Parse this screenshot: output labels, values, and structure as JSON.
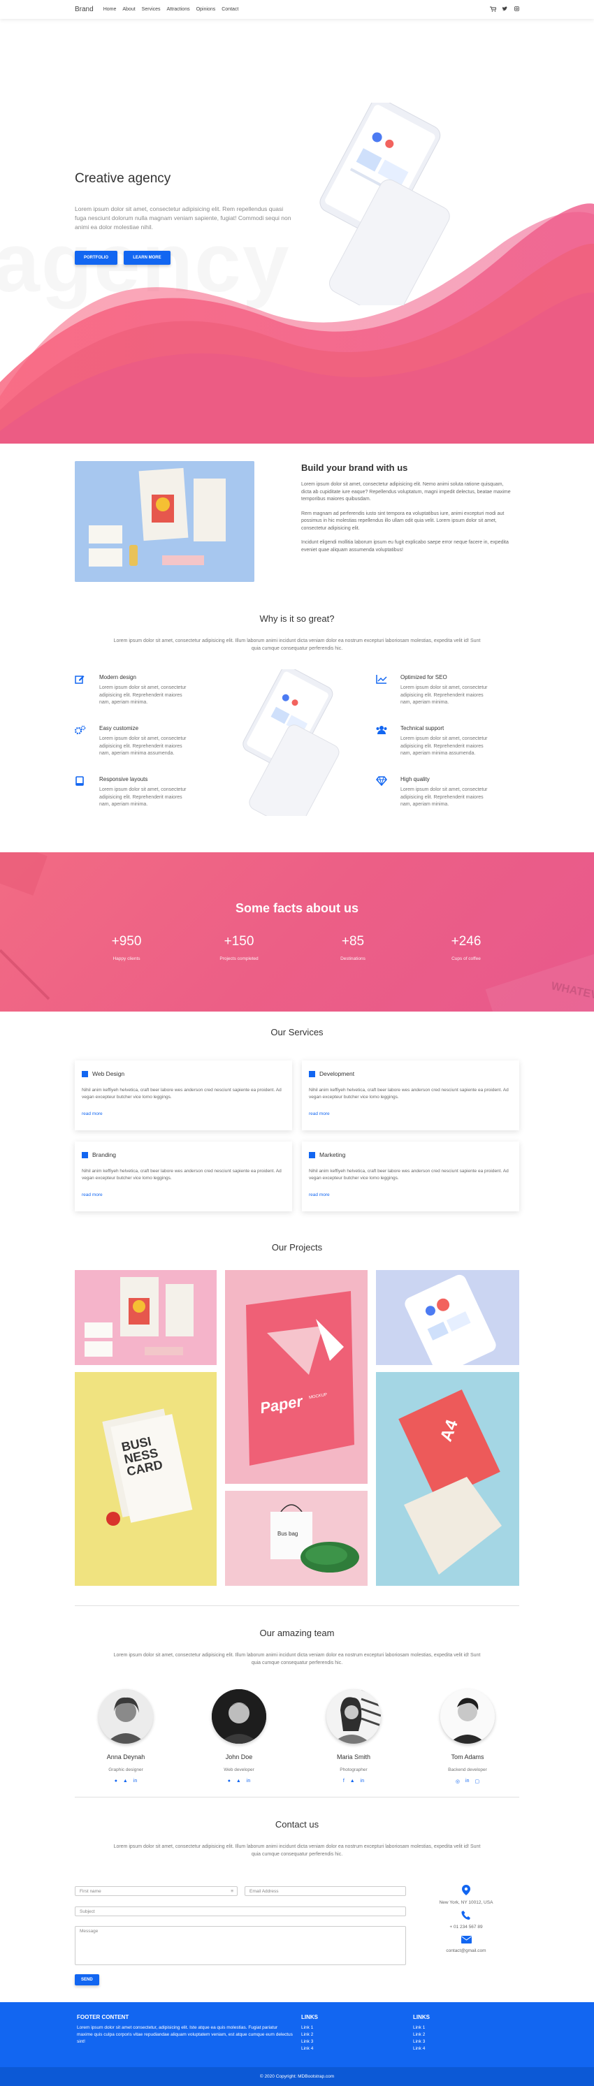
{
  "navbar": {
    "brand": "Brand",
    "links": [
      "Home",
      "About",
      "Services",
      "Attractions",
      "Opinions",
      "Contact"
    ]
  },
  "hero": {
    "title": "Creative agency",
    "text": "Lorem ipsum dolor sit amet, consectetur adipisicing elit. Rem repellendus quasi fuga nesciunt dolorum nulla magnam veniam sapiente, fugiat! Commodi sequi non animi ea dolor molestiae nihil.",
    "bg_text": "agency",
    "btn_portfolio": "PORTFOLIO",
    "btn_learn": "LEARN MORE"
  },
  "brand_section": {
    "title": "Build your brand with us",
    "p1": "Lorem ipsum dolor sit amet, consectetur adipisicing elit. Nemo animi soluta ratione quisquam, dicta ab cupiditate iure eaque? Repellendus voluptatum, magni impedit delectus, beatae maxime temporibus maiores quibusdam.",
    "p2": "Rem magnam ad perferendis iusto sint tempora ea voluptatibus iure, animi excepturi modi aut possimus in hic molestias repellendus illo ullam odit quia velit. Lorem ipsum dolor sit amet, consectetur adipisicing elit.",
    "p3": "Incidunt eligendi mollitia laborum ipsum eu fugit explicabo saepe error neque facere in, expedita eveniet quae aliquam assumenda voluptatibus!"
  },
  "why": {
    "title": "Why is it so great?",
    "subtitle": "Lorem ipsum dolor sit amet, consectetur adipisicing elit. Illum laborum animi incidunt dicta veniam dolor ea nostrum excepturi laboriosam molestias, expedita velit id! Sunt quia cumque consequatur perferendis hic.",
    "features": [
      {
        "title": "Modern design",
        "text": "Lorem ipsum dolor sit amet, consectetur adipisicing elit. Reprehenderit maiores nam, aperiam minima."
      },
      {
        "title": "Easy customize",
        "text": "Lorem ipsum dolor sit amet, consectetur adipisicing elit. Reprehenderit maiores nam, aperiam minima assumenda."
      },
      {
        "title": "Responsive layouts",
        "text": "Lorem ipsum dolor sit amet, consectetur adipisicing elit. Reprehenderit maiores nam, aperiam minima."
      },
      {
        "title": "Optimized for SEO",
        "text": "Lorem ipsum dolor sit amet, consectetur adipisicing elit. Reprehenderit maiores nam, aperiam minima."
      },
      {
        "title": "Technical support",
        "text": "Lorem ipsum dolor sit amet, consectetur adipisicing elit. Reprehenderit maiores nam, aperiam minima assumenda."
      },
      {
        "title": "High quality",
        "text": "Lorem ipsum dolor sit amet, consectetur adipisicing elit. Reprehenderit maiores nam, aperiam minima."
      }
    ]
  },
  "facts": {
    "title": "Some facts about us",
    "items": [
      {
        "num": "+950",
        "label": "Happy clients"
      },
      {
        "num": "+150",
        "label": "Projects completed"
      },
      {
        "num": "+85",
        "label": "Destinations"
      },
      {
        "num": "+246",
        "label": "Cups of coffee"
      }
    ],
    "bg_word": "WHATEV"
  },
  "services": {
    "title": "Our Services",
    "items": [
      {
        "title": "Web Design",
        "text": "Nihil anim keffiyeh helvetica, craft beer labore wes anderson cred nesciunt sapiente ea proident. Ad vegan excepteur butcher vice lomo leggings.",
        "link": "read more"
      },
      {
        "title": "Development",
        "text": "Nihil anim keffiyeh helvetica, craft beer labore wes anderson cred nesciunt sapiente ea proident. Ad vegan excepteur butcher vice lomo leggings.",
        "link": "read more"
      },
      {
        "title": "Branding",
        "text": "Nihil anim keffiyeh helvetica, craft beer labore wes anderson cred nesciunt sapiente ea proident. Ad vegan excepteur butcher vice lomo leggings.",
        "link": "read more"
      },
      {
        "title": "Marketing",
        "text": "Nihil anim keffiyeh helvetica, craft beer labore wes anderson cred nesciunt sapiente ea proident. Ad vegan excepteur butcher vice lomo leggings.",
        "link": "read more"
      }
    ]
  },
  "projects": {
    "title": "Our Projects",
    "paper_label": "Paper",
    "mockup_label": "MOCKUP",
    "card_text": "BUSI NESS CARD",
    "bag_text": "Bus bag",
    "a4_text": "A4"
  },
  "team": {
    "title": "Our amazing team",
    "subtitle": "Lorem ipsum dolor sit amet, consectetur adipisicing elit. Illum laborum animi incidunt dicta veniam dolor ea nostrum excepturi laboriosam molestias, expedita velit id! Sunt quia cumque consequatur perferendis hic.",
    "members": [
      {
        "name": "Anna Deynah",
        "role": "Graphic designer"
      },
      {
        "name": "John Doe",
        "role": "Web developer"
      },
      {
        "name": "Maria Smith",
        "role": "Photographer"
      },
      {
        "name": "Tom Adams",
        "role": "Backend developer"
      }
    ]
  },
  "contact": {
    "title": "Contact us",
    "subtitle": "Lorem ipsum dolor sit amet, consectetur adipisicing elit. Illum laborum animi incidunt dicta veniam dolor ea nostrum excepturi laboriosam molestias, expedita velit id! Sunt quia cumque consequatur perferendis hic.",
    "first_name": "First name",
    "email": "Email Address",
    "subject": "Subject",
    "message": "Message",
    "send": "SEND",
    "address": "New York, NY 10012, USA",
    "phone": "+ 01 234 567 89",
    "email_addr": "contact@gmail.com"
  },
  "footer": {
    "title": "FOOTER CONTENT",
    "text": "Lorem ipsum dolor sit amet consectetur, adipisicing elit. Iste atque ea quis molestias. Fugiat pariatur maxime quis culpa corporis vitae repudiandae aliquam voluptatem veniam, est atque cumque eum delectus sint!",
    "links_title_1": "LINKS",
    "links_title_2": "LINKS",
    "links": [
      "Link 1",
      "Link 2",
      "Link 3",
      "Link 4"
    ],
    "copyright": "© 2020 Copyright: MDBootstrap.com"
  },
  "colors": {
    "primary": "#1266f1",
    "pink": "#f05a7e",
    "footer": "#1266f1"
  }
}
